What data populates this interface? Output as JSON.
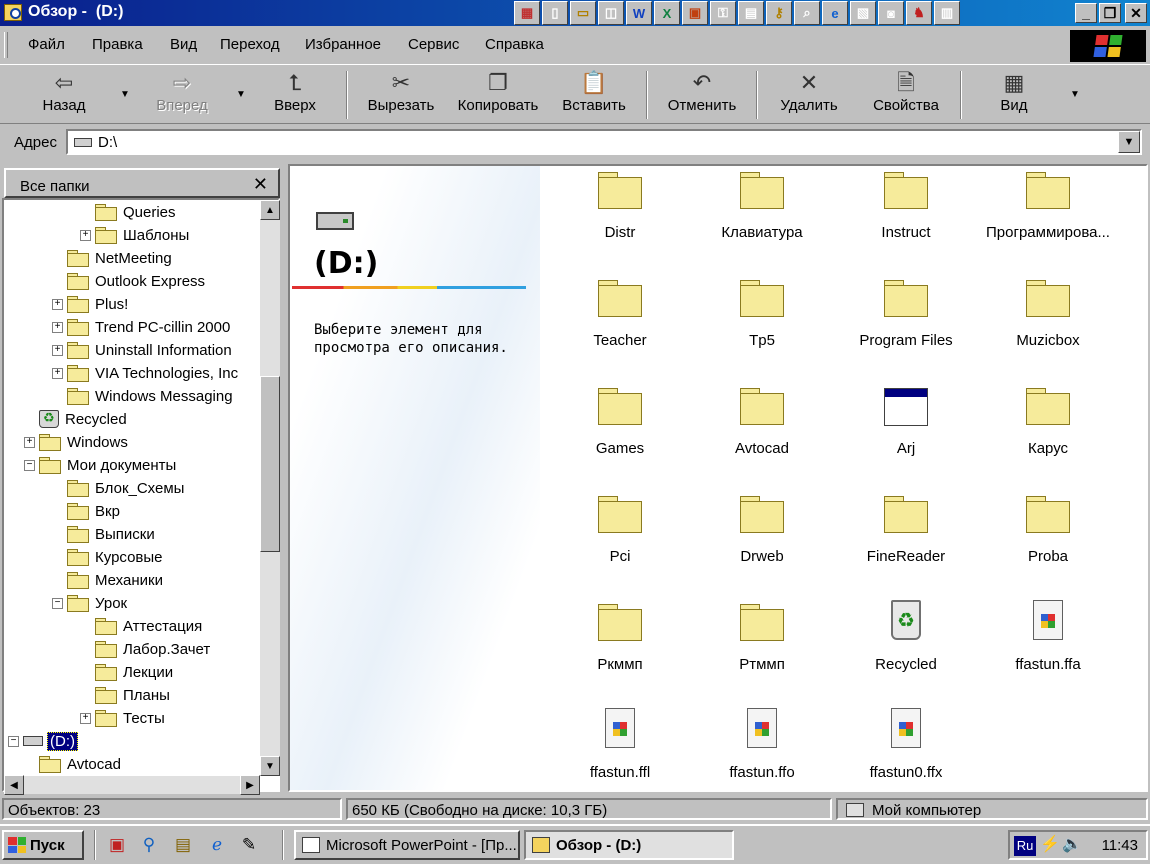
{
  "window": {
    "title": "Обзор -  (D:)"
  },
  "menu": [
    "Файл",
    "Правка",
    "Вид",
    "Переход",
    "Избранное",
    "Сервис",
    "Справка"
  ],
  "toolbar": {
    "back": "Назад",
    "forward": "Вперед",
    "up": "Вверх",
    "cut": "Вырезать",
    "copy": "Копировать",
    "paste": "Вставить",
    "undo": "Отменить",
    "delete": "Удалить",
    "properties": "Свойства",
    "view": "Вид"
  },
  "address": {
    "label": "Адрес",
    "value": "D:\\"
  },
  "tree": {
    "header": "Все папки",
    "items": [
      {
        "label": "Queries",
        "expander": "",
        "icon": "folder-icon"
      },
      {
        "label": "Шаблоны",
        "expander": "+",
        "icon": "folder-icon"
      },
      {
        "label": "NetMeeting",
        "expander": "",
        "icon": "folder-icon"
      },
      {
        "label": "Outlook Express",
        "expander": "",
        "icon": "folder-icon"
      },
      {
        "label": "Plus!",
        "expander": "+",
        "icon": "folder-icon"
      },
      {
        "label": "Trend PC-cillin 2000",
        "expander": "+",
        "icon": "folder-icon"
      },
      {
        "label": "Uninstall Information",
        "expander": "+",
        "icon": "folder-icon"
      },
      {
        "label": "VIA Technologies, Inc",
        "expander": "+",
        "icon": "folder-icon"
      },
      {
        "label": "Windows Messaging",
        "expander": "",
        "icon": "folder-icon"
      },
      {
        "label": "Recycled",
        "expander": "",
        "icon": "recycle-bin-icon"
      },
      {
        "label": "Windows",
        "expander": "+",
        "icon": "folder-icon"
      },
      {
        "label": "Мои документы",
        "expander": "−",
        "icon": "folder-open-icon"
      },
      {
        "label": "Блок_Схемы",
        "expander": "",
        "icon": "folder-icon"
      },
      {
        "label": "Вкр",
        "expander": "",
        "icon": "folder-icon"
      },
      {
        "label": "Выписки",
        "expander": "",
        "icon": "folder-icon"
      },
      {
        "label": "Курсовые",
        "expander": "",
        "icon": "folder-icon"
      },
      {
        "label": "Механики",
        "expander": "",
        "icon": "folder-icon"
      },
      {
        "label": "Урок",
        "expander": "−",
        "icon": "folder-icon"
      },
      {
        "label": "Аттестация",
        "expander": "",
        "icon": "folder-icon"
      },
      {
        "label": "Лабор.Зачет",
        "expander": "",
        "icon": "folder-icon"
      },
      {
        "label": "Лекции",
        "expander": "",
        "icon": "folder-icon"
      },
      {
        "label": "Планы",
        "expander": "",
        "icon": "folder-icon"
      },
      {
        "label": "Тесты",
        "expander": "+",
        "icon": "folder-icon"
      },
      {
        "label": "(D:)",
        "expander": "−",
        "icon": "drive-icon",
        "selected": true
      },
      {
        "label": "Avtocad",
        "expander": "",
        "icon": "folder-icon"
      }
    ]
  },
  "info": {
    "title": "(D:)",
    "description": "Выберите элемент для просмотра его описания."
  },
  "files": [
    {
      "name": "Distr",
      "type": "folder"
    },
    {
      "name": "Клавиатура",
      "type": "folder"
    },
    {
      "name": "Instruct",
      "type": "folder"
    },
    {
      "name": "Программирова...",
      "type": "folder"
    },
    {
      "name": "Teacher",
      "type": "folder"
    },
    {
      "name": "Tp5",
      "type": "folder"
    },
    {
      "name": "Program Files",
      "type": "folder"
    },
    {
      "name": "Muzicbox",
      "type": "folder"
    },
    {
      "name": "Games",
      "type": "folder"
    },
    {
      "name": "Avtocad",
      "type": "folder"
    },
    {
      "name": "Arj",
      "type": "application"
    },
    {
      "name": "Карус",
      "type": "folder"
    },
    {
      "name": "Pci",
      "type": "folder"
    },
    {
      "name": "Drweb",
      "type": "folder"
    },
    {
      "name": "FineReader",
      "type": "folder"
    },
    {
      "name": "Proba",
      "type": "folder"
    },
    {
      "name": "Ркммп",
      "type": "folder"
    },
    {
      "name": "Ртммп",
      "type": "folder"
    },
    {
      "name": "Recycled",
      "type": "recycle-bin"
    },
    {
      "name": "ffastun.ffa",
      "type": "document"
    },
    {
      "name": "ffastun.ffl",
      "type": "document"
    },
    {
      "name": "ffastun.ffo",
      "type": "document"
    },
    {
      "name": "ffastun0.ffx",
      "type": "document"
    }
  ],
  "status": {
    "objects": "Объектов: 23",
    "size": "650 КБ (Свободно на диске: 10,3 ГБ)",
    "location": "Мой компьютер"
  },
  "taskbar": {
    "start": "Пуск",
    "tasks": [
      {
        "label": "Microsoft PowerPoint - [Пр...",
        "active": false
      },
      {
        "label": "Обзор -  (D:)",
        "active": true
      }
    ],
    "lang": "Ru",
    "time": "11:43"
  },
  "colors": {
    "title_bar": "#0a1e8c",
    "selection": "#000080",
    "face": "#c0c0c0"
  }
}
